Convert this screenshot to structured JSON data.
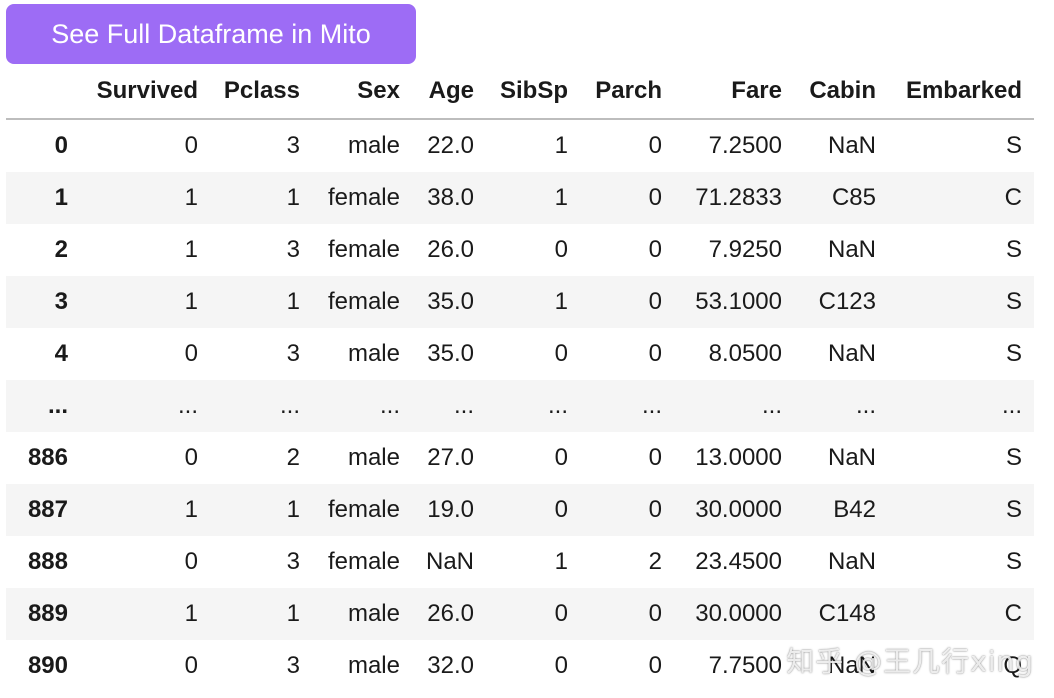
{
  "button": {
    "label": "See Full Dataframe in Mito",
    "color": "#9d6cf5"
  },
  "table": {
    "columns": [
      "",
      "Survived",
      "Pclass",
      "Sex",
      "Age",
      "SibSp",
      "Parch",
      "Fare",
      "Cabin",
      "Embarked"
    ],
    "rows": [
      [
        "0",
        "0",
        "3",
        "male",
        "22.0",
        "1",
        "0",
        "7.2500",
        "NaN",
        "S"
      ],
      [
        "1",
        "1",
        "1",
        "female",
        "38.0",
        "1",
        "0",
        "71.2833",
        "C85",
        "C"
      ],
      [
        "2",
        "1",
        "3",
        "female",
        "26.0",
        "0",
        "0",
        "7.9250",
        "NaN",
        "S"
      ],
      [
        "3",
        "1",
        "1",
        "female",
        "35.0",
        "1",
        "0",
        "53.1000",
        "C123",
        "S"
      ],
      [
        "4",
        "0",
        "3",
        "male",
        "35.0",
        "0",
        "0",
        "8.0500",
        "NaN",
        "S"
      ],
      [
        "...",
        "...",
        "...",
        "...",
        "...",
        "...",
        "...",
        "...",
        "...",
        "..."
      ],
      [
        "886",
        "0",
        "2",
        "male",
        "27.0",
        "0",
        "0",
        "13.0000",
        "NaN",
        "S"
      ],
      [
        "887",
        "1",
        "1",
        "female",
        "19.0",
        "0",
        "0",
        "30.0000",
        "B42",
        "S"
      ],
      [
        "888",
        "0",
        "3",
        "female",
        "NaN",
        "1",
        "2",
        "23.4500",
        "NaN",
        "S"
      ],
      [
        "889",
        "1",
        "1",
        "male",
        "26.0",
        "0",
        "0",
        "30.0000",
        "C148",
        "C"
      ],
      [
        "890",
        "0",
        "3",
        "male",
        "32.0",
        "0",
        "0",
        "7.7500",
        "NaN",
        "Q"
      ]
    ]
  },
  "watermark": "知乎 @王几行xing"
}
